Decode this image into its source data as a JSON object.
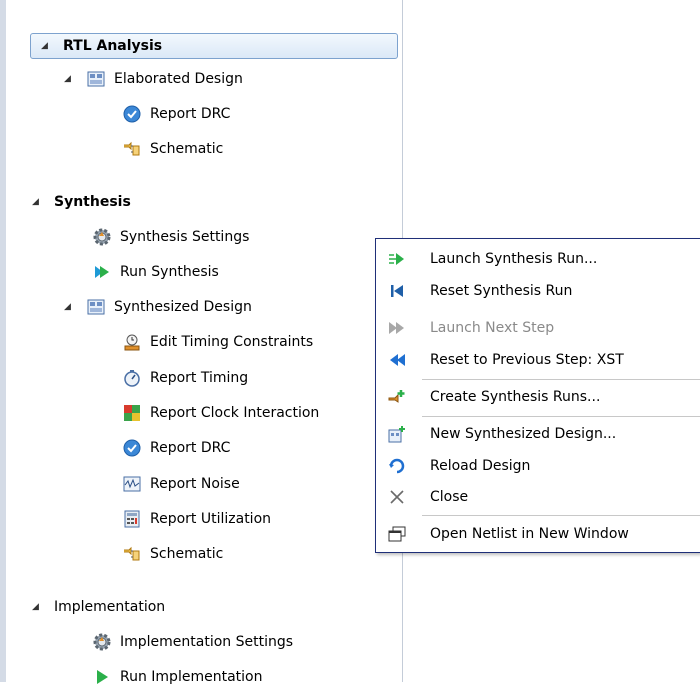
{
  "tree": {
    "rtl_analysis": "RTL Analysis",
    "elaborated_design": "Elaborated Design",
    "rtl_report_drc": "Report DRC",
    "rtl_schematic": "Schematic",
    "synthesis": "Synthesis",
    "synthesis_settings": "Synthesis Settings",
    "run_synthesis": "Run Synthesis",
    "synthesized_design": "Synthesized Design",
    "edit_timing_constraints": "Edit Timing Constraints",
    "report_timing": "Report Timing",
    "report_clock_interaction": "Report Clock Interaction",
    "syn_report_drc": "Report DRC",
    "report_noise": "Report Noise",
    "report_utilization": "Report Utilization",
    "syn_schematic": "Schematic",
    "implementation": "Implementation",
    "implementation_settings": "Implementation Settings",
    "run_implementation": "Run Implementation"
  },
  "context_menu": {
    "launch_synthesis_run": "Launch Synthesis Run...",
    "reset_synthesis_run": "Reset Synthesis Run",
    "launch_next_step": "Launch Next Step",
    "reset_to_previous_step": "Reset to Previous Step: XST",
    "create_synthesis_runs": "Create Synthesis Runs...",
    "new_synthesized_design": "New Synthesized Design...",
    "reload_design": "Reload Design",
    "close": "Close",
    "open_netlist_new_window": "Open Netlist in New Window"
  }
}
